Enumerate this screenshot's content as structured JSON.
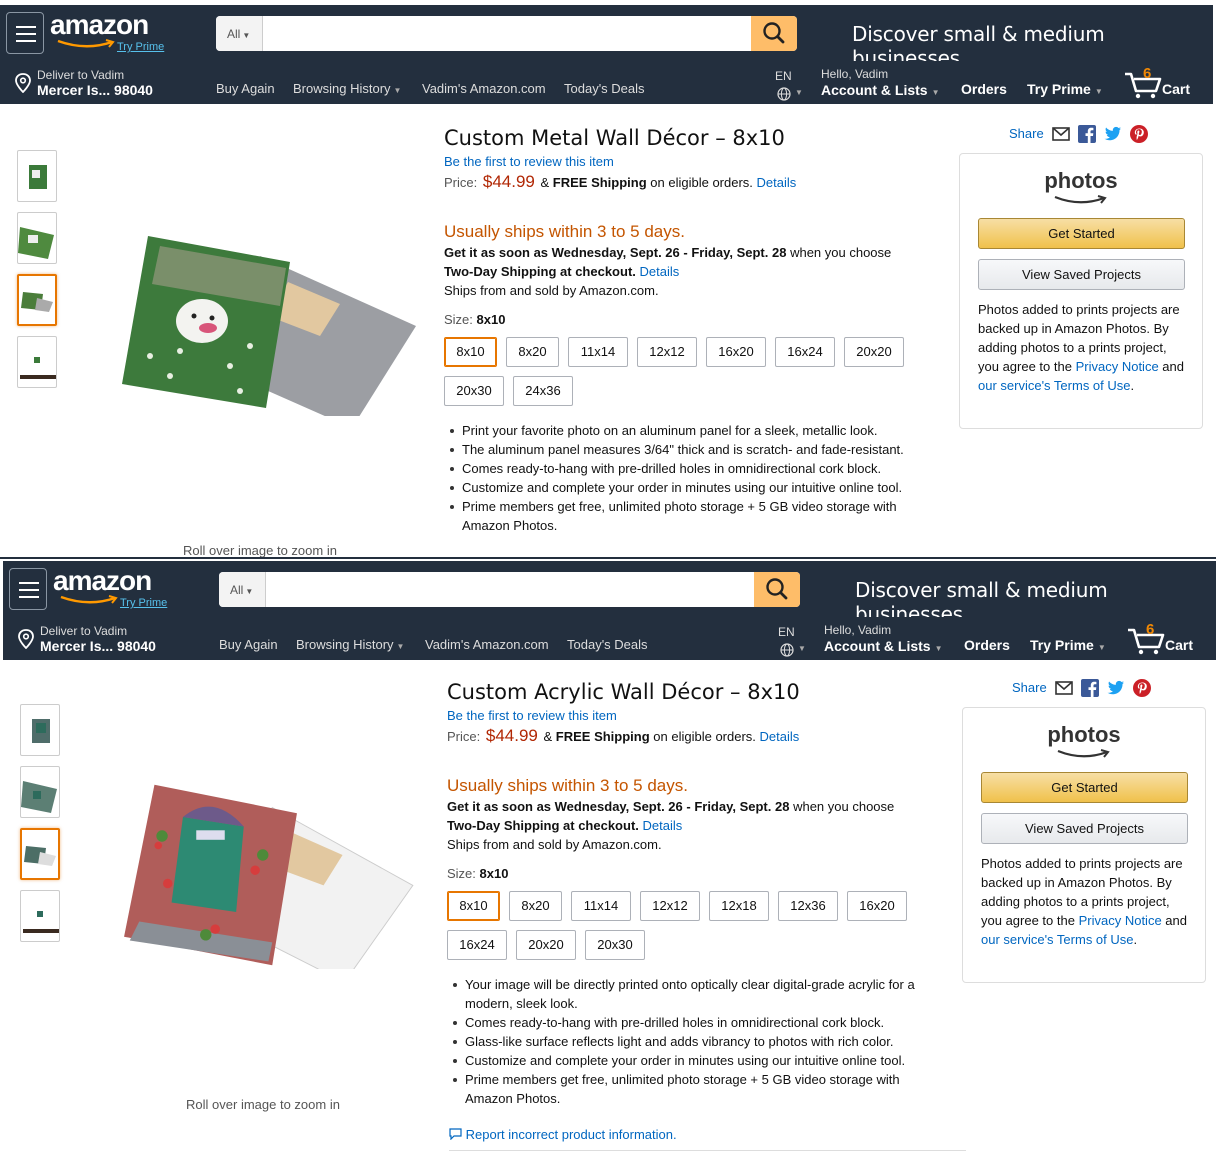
{
  "header": {
    "logo_text": "amazon",
    "try_prime": "Try Prime",
    "search_category": "All",
    "search_placeholder": "",
    "promo": "Discover small & medium businesses",
    "deliver_line1": "Deliver to Vadim",
    "deliver_line2": "Mercer Is... 98040",
    "nav_buy_again": "Buy Again",
    "nav_browsing_history": "Browsing History",
    "nav_vadims_amazon": "Vadim's Amazon.com",
    "nav_todays_deals": "Today's Deals",
    "lang": "EN",
    "account_greeting": "Hello, Vadim",
    "account_lists": "Account & Lists",
    "orders": "Orders",
    "try_prime_nav": "Try Prime",
    "cart_count": "6",
    "cart_label": "Cart"
  },
  "colors": {
    "header_bg": "#232f3e",
    "search_button": "#febd69",
    "price": "#b12704",
    "ships": "#c45500",
    "link": "#0066c0",
    "selected_border": "#e77600"
  },
  "products": [
    {
      "title": "Custom Metal Wall Décor – 8x10",
      "review_link": "Be the first to review this item",
      "price_label": "Price:",
      "price": "$44.99",
      "shipping_amp": "&",
      "shipping_bold": "FREE Shipping",
      "shipping_rest": "on eligible orders.",
      "shipping_details": "Details",
      "ships_within": "Usually ships within 3 to 5 days.",
      "eta_bold": "Get it as soon as Wednesday, Sept. 26 - Friday, Sept. 28",
      "eta_rest": "when you choose",
      "eta_bold2": "Two-Day Shipping at checkout.",
      "eta_details": "Details",
      "sold_by": "Ships from and sold by Amazon.com.",
      "size_label": "Size:",
      "size_selected": "8x10",
      "sizes": [
        "8x10",
        "8x20",
        "11x14",
        "12x12",
        "16x20",
        "16x24",
        "20x20",
        "20x30",
        "24x36"
      ],
      "bullets": [
        "Print your favorite photo on an aluminum panel for a sleek, metallic look.",
        "The aluminum panel measures 3/64\" thick and is scratch- and fade-resistant.",
        "Comes ready-to-hang with pre-drilled holes in omnidirectional cork block.",
        "Customize and complete your order in minutes using our intuitive online tool.",
        "Prime members get free, unlimited photo storage + 5 GB video storage with Amazon Photos."
      ],
      "zoom_hint": "Roll over image to zoom in"
    },
    {
      "title": "Custom Acrylic Wall Décor – 8x10",
      "review_link": "Be the first to review this item",
      "price_label": "Price:",
      "price": "$44.99",
      "shipping_amp": "&",
      "shipping_bold": "FREE Shipping",
      "shipping_rest": "on eligible orders.",
      "shipping_details": "Details",
      "ships_within": "Usually ships within 3 to 5 days.",
      "eta_bold": "Get it as soon as Wednesday, Sept. 26 - Friday, Sept. 28",
      "eta_rest": "when you choose",
      "eta_bold2": "Two-Day Shipping at checkout.",
      "eta_details": "Details",
      "sold_by": "Ships from and sold by Amazon.com.",
      "size_label": "Size:",
      "size_selected": "8x10",
      "sizes": [
        "8x10",
        "8x20",
        "11x14",
        "12x12",
        "12x18",
        "12x36",
        "16x20",
        "16x24",
        "20x20",
        "20x30"
      ],
      "bullets": [
        "Your image will be directly printed onto optically clear digital-grade acrylic for a modern, sleek look.",
        "Comes ready-to-hang with pre-drilled holes in omnidirectional cork block.",
        "Glass-like surface reflects light and adds vibrancy to photos with rich color.",
        "Customize and complete your order in minutes using our intuitive online tool.",
        "Prime members get free, unlimited photo storage + 5 GB video storage with Amazon Photos."
      ],
      "zoom_hint": "Roll over image to zoom in",
      "report": "Report incorrect product information."
    }
  ],
  "sidebar": {
    "share": "Share",
    "photos_logo": "photos",
    "get_started": "Get Started",
    "view_saved": "View Saved Projects",
    "note_text": "Photos added to prints projects are backed up in Amazon Photos. By adding photos to a prints project, you agree to the",
    "privacy_link": "Privacy Notice",
    "note_and": "and",
    "terms_link": "our service's Terms of Use",
    "note_end": "."
  }
}
